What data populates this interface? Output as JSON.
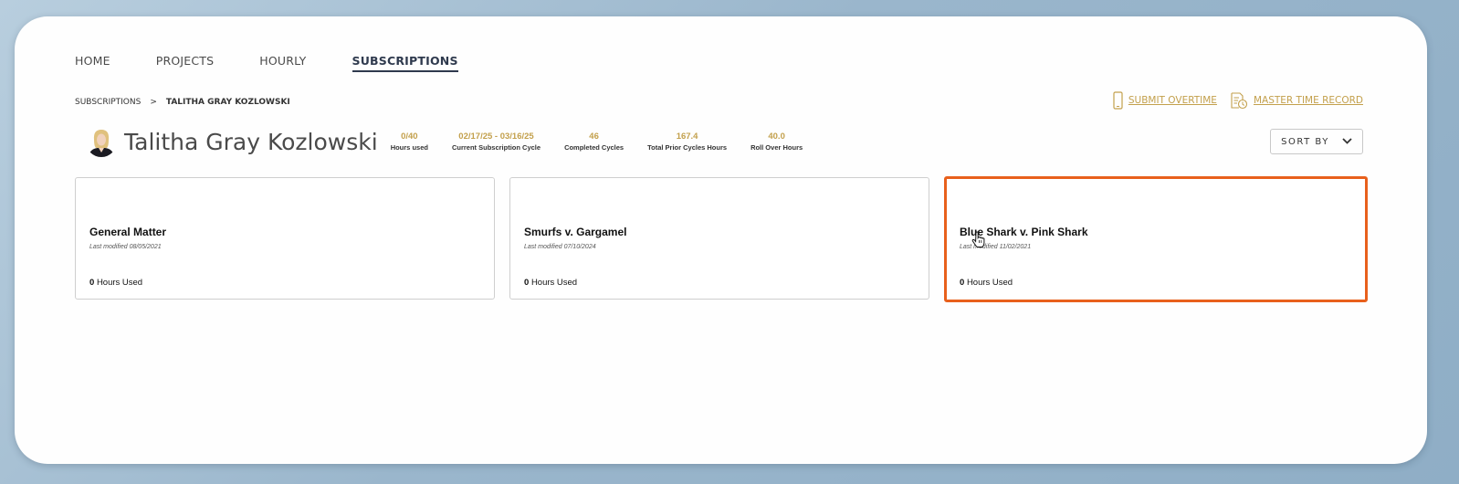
{
  "nav": {
    "items": [
      {
        "label": "HOME"
      },
      {
        "label": "PROJECTS"
      },
      {
        "label": "HOURLY"
      },
      {
        "label": "SUBSCRIPTIONS"
      }
    ],
    "active_index": 3
  },
  "breadcrumb": {
    "parent": "SUBSCRIPTIONS",
    "separator": ">",
    "current": "TALITHA GRAY KOZLOWSKI"
  },
  "actions": {
    "submit_overtime": {
      "label": "SUBMIT OVERTIME",
      "icon": "phone-icon"
    },
    "master_time_record": {
      "label": "MASTER TIME RECORD",
      "icon": "time-record-icon"
    }
  },
  "client": {
    "name": "Talitha Gray Kozlowski",
    "stats": [
      {
        "value": "0/40",
        "label": "Hours used"
      },
      {
        "value": "02/17/25 - 03/16/25",
        "label": "Current Subscription Cycle"
      },
      {
        "value": "46",
        "label": "Completed Cycles"
      },
      {
        "value": "167.4",
        "label": "Total Prior Cycles Hours"
      },
      {
        "value": "40.0",
        "label": "Roll Over Hours"
      }
    ]
  },
  "sort": {
    "label": "SORT BY"
  },
  "cards": [
    {
      "title": "General Matter",
      "modified": "Last modified 08/05/2021",
      "hours_value": "0",
      "hours_label": "Hours Used"
    },
    {
      "title": "Smurfs v. Gargamel",
      "modified": "Last modified 07/10/2024",
      "hours_value": "0",
      "hours_label": "Hours Used"
    },
    {
      "title": "Blue Shark v. Pink Shark",
      "modified": "Last modified 11/02/2021",
      "hours_value": "0",
      "hours_label": "Hours Used"
    }
  ],
  "colors": {
    "accent_gold": "#c3a04c",
    "highlight_orange": "#e8601c",
    "nav_active": "#2f3a4e"
  }
}
